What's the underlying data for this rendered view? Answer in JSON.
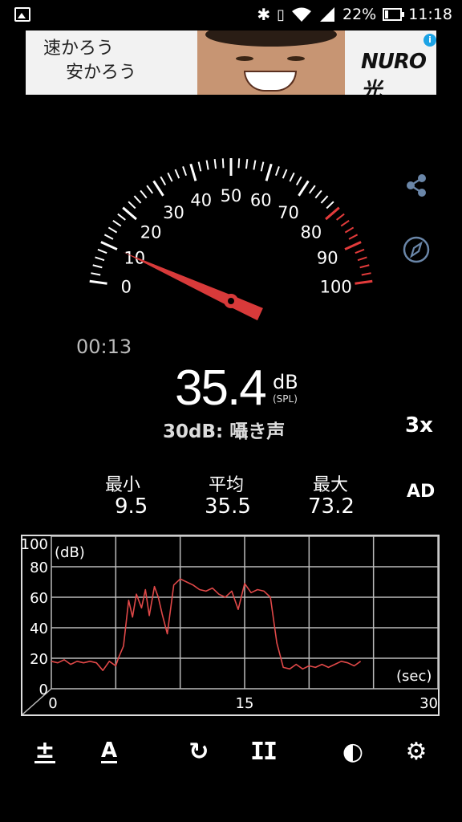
{
  "status_bar": {
    "battery": "22%",
    "time": "11:18",
    "icons": [
      "image-icon",
      "bluetooth-icon",
      "vibrate-icon",
      "wifi-icon",
      "signal-icon",
      "battery-icon"
    ]
  },
  "ad": {
    "copy_line1": "速かろう",
    "copy_line2": "安かろう",
    "brand": "NURO光",
    "info_icon": "i",
    "close_icon": "✕"
  },
  "gauge": {
    "ticks": [
      "0",
      "10",
      "20",
      "30",
      "40",
      "50",
      "60",
      "70",
      "80",
      "90",
      "100"
    ],
    "needle_value": 10,
    "red_zone_start": 80,
    "colors": {
      "needle": "#d83a3a",
      "red_zone": "#e33b3b",
      "tick": "#ffffff"
    }
  },
  "timer": "00:13",
  "reading": {
    "value": "35.4",
    "unit": "dB",
    "unit_sub": "(SPL)",
    "level_text": "30dB: 囁き声",
    "multiplier": "3x"
  },
  "stats": {
    "min_label": "最小",
    "min_value": "9.5",
    "avg_label": "平均",
    "avg_value": "35.5",
    "max_label": "最大",
    "max_value": "73.2",
    "mode": "AD"
  },
  "chart_data": {
    "type": "line",
    "ylabel": "(dB)",
    "xlabel": "(sec)",
    "ylim": [
      0,
      100
    ],
    "xlim": [
      0,
      30
    ],
    "y_ticks": [
      "0",
      "20",
      "40",
      "60",
      "80",
      "100"
    ],
    "x_ticks": [
      "0",
      "15",
      "30"
    ],
    "grid": true,
    "series": [
      {
        "color": "#e04848",
        "x": [
          0,
          0.5,
          1,
          1.5,
          2,
          2.5,
          3,
          3.5,
          4,
          4.5,
          5,
          5.2,
          5.6,
          6,
          6.3,
          6.6,
          7,
          7.3,
          7.6,
          8,
          8.3,
          8.6,
          9,
          9.5,
          10,
          10.5,
          11,
          11.5,
          12,
          12.5,
          13,
          13.5,
          14,
          14.5,
          15,
          15.5,
          16,
          16.5,
          17,
          17.5,
          18,
          18.5,
          19,
          19.5,
          20,
          20.5,
          21,
          21.5,
          22,
          22.5,
          23,
          23.5,
          24
        ],
        "y": [
          18,
          17,
          19,
          16,
          18,
          17,
          18,
          17,
          12,
          18,
          15,
          20,
          28,
          58,
          47,
          62,
          53,
          65,
          48,
          67,
          60,
          49,
          36,
          68,
          72,
          70,
          68,
          65,
          64,
          66,
          62,
          60,
          64,
          52,
          69,
          63,
          65,
          64,
          60,
          30,
          14,
          13,
          16,
          13,
          15,
          14,
          16,
          14,
          16,
          18,
          17,
          15,
          18
        ]
      }
    ]
  },
  "toolbar": {
    "calibrate_label": "±",
    "weighting_label": "A",
    "reset_icon": "↻",
    "pause_icon": "II",
    "theme_icon": "◐",
    "settings_icon": "⚙"
  }
}
